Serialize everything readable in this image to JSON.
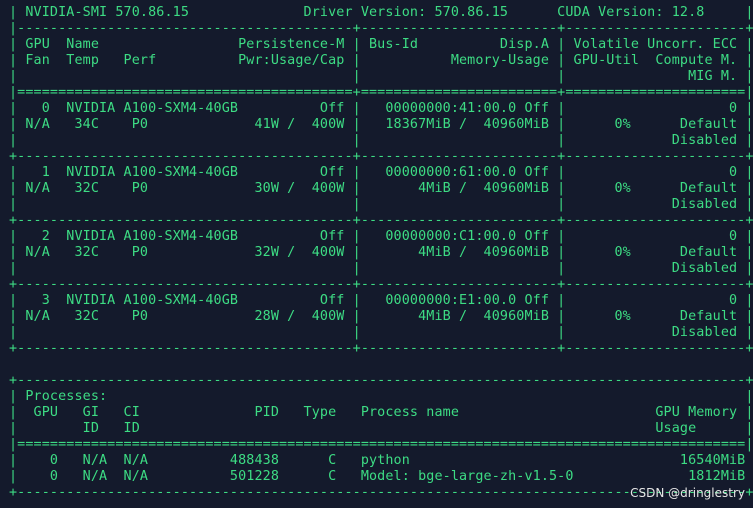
{
  "terminal": {
    "colors": {
      "background": "#141a2c",
      "foreground": "#3ddc84",
      "watermark": "#e6e6e6"
    },
    "lines": [
      "| NVIDIA-SMI 570.86.15              Driver Version: 570.86.15      CUDA Version: 12.8     |",
      "|-----------------------------------------+------------------------+----------------------+",
      "| GPU  Name                 Persistence-M | Bus-Id          Disp.A | Volatile Uncorr. ECC |",
      "| Fan  Temp   Perf          Pwr:Usage/Cap |           Memory-Usage | GPU-Util  Compute M. |",
      "|                                         |                        |               MIG M. |",
      "|=========================================+========================+======================|",
      "|   0  NVIDIA A100-SXM4-40GB          Off |   00000000:41:00.0 Off |                    0 |",
      "| N/A   34C    P0             41W /  400W |   18367MiB /  40960MiB |      0%      Default |",
      "|                                         |                        |             Disabled |",
      "+-----------------------------------------+------------------------+----------------------+",
      "|   1  NVIDIA A100-SXM4-40GB          Off |   00000000:61:00.0 Off |                    0 |",
      "| N/A   32C    P0             30W /  400W |       4MiB /  40960MiB |      0%      Default |",
      "|                                         |                        |             Disabled |",
      "+-----------------------------------------+------------------------+----------------------+",
      "|   2  NVIDIA A100-SXM4-40GB          Off |   00000000:C1:00.0 Off |                    0 |",
      "| N/A   32C    P0             32W /  400W |       4MiB /  40960MiB |      0%      Default |",
      "|                                         |                        |             Disabled |",
      "+-----------------------------------------+------------------------+----------------------+",
      "|   3  NVIDIA A100-SXM4-40GB          Off |   00000000:E1:00.0 Off |                    0 |",
      "| N/A   32C    P0             28W /  400W |       4MiB /  40960MiB |      0%      Default |",
      "|                                         |                        |             Disabled |",
      "+-----------------------------------------+------------------------+----------------------+",
      "",
      "+-----------------------------------------------------------------------------------------+",
      "| Processes:                                                                              |",
      "|  GPU   GI   CI              PID   Type   Process name                        GPU Memory |",
      "|        ID   ID                                                               Usage      |",
      "|=========================================================================================|",
      "|    0   N/A  N/A          488438      C   python                                 16540MiB |",
      "|    0   N/A  N/A          501228      C   Model: bge-large-zh-v1.5-0              1812MiB |",
      "+-----------------------------------------------------------------------------------------+"
    ]
  },
  "watermark": {
    "text": "CSDN @dringlestry"
  }
}
